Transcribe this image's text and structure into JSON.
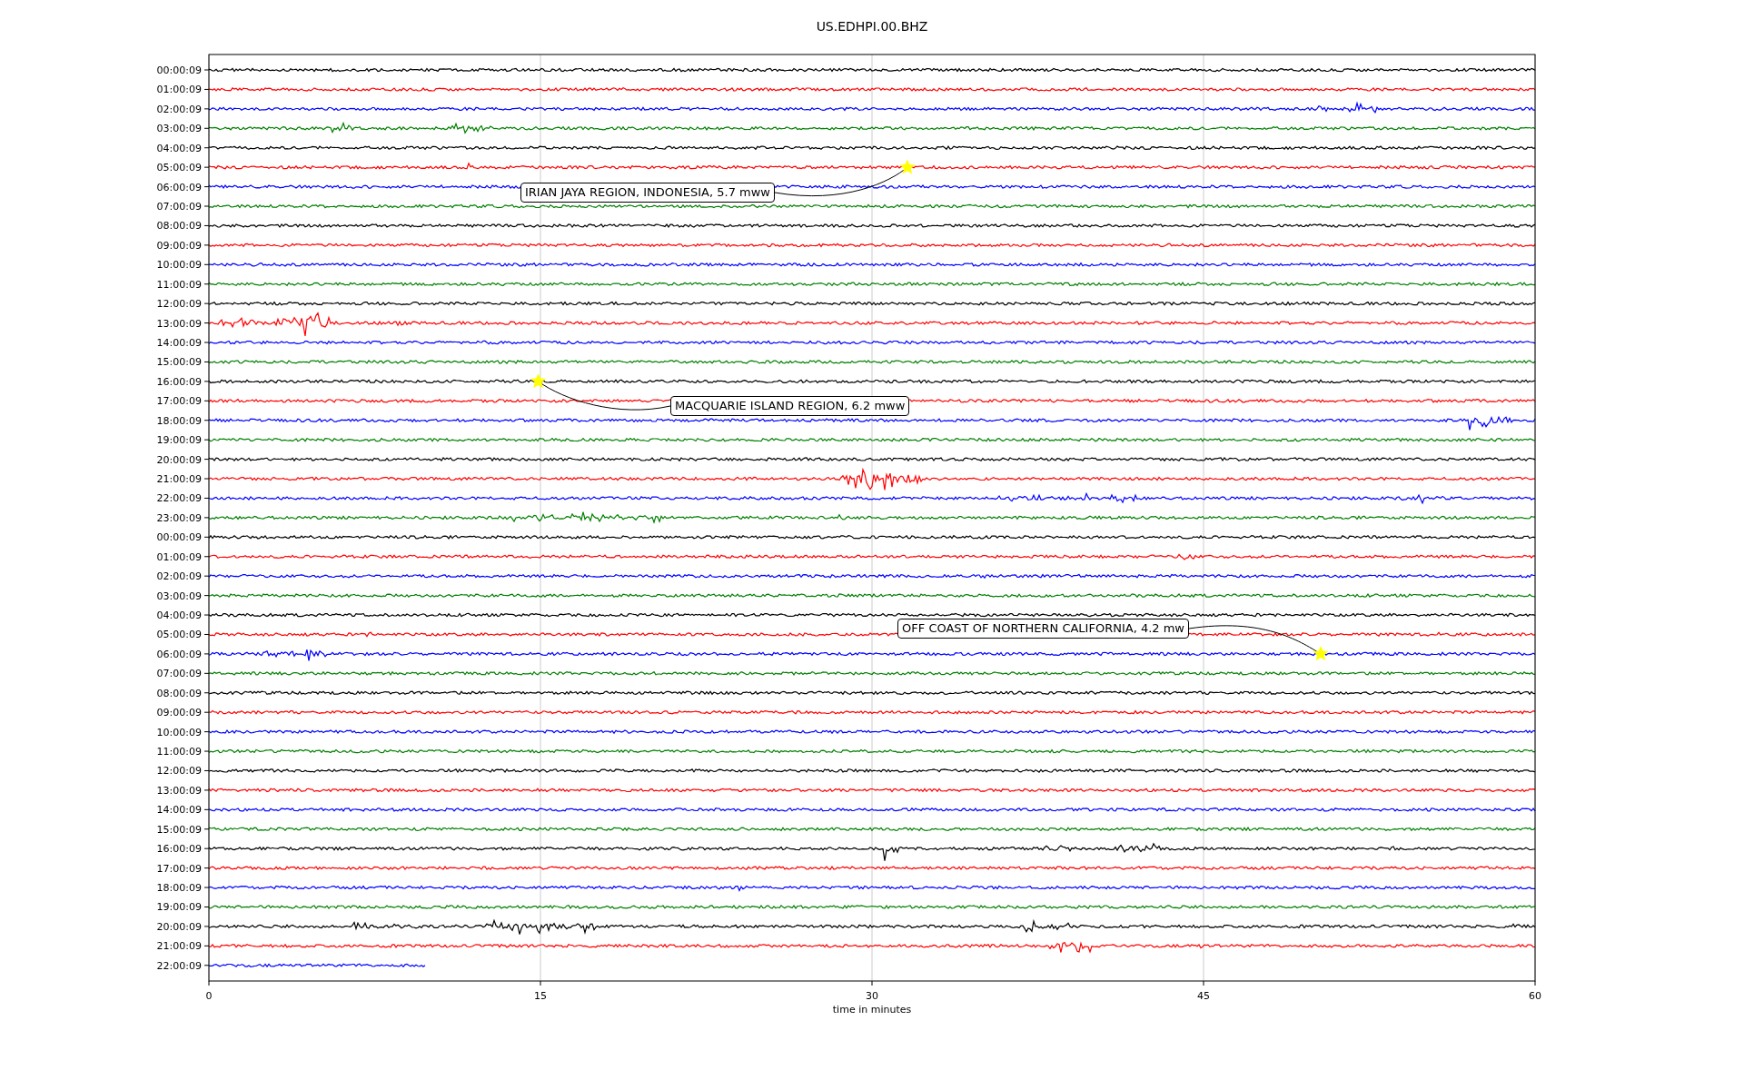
{
  "title": "US.EDHPI.00.BHZ",
  "xlabel": "time in minutes",
  "xticks": [
    "0",
    "15",
    "30",
    "45",
    "60"
  ],
  "traces": [
    {
      "label": "00:00:09",
      "color": "#000000"
    },
    {
      "label": "01:00:09",
      "color": "#ff0000"
    },
    {
      "label": "02:00:09",
      "color": "#0000ff"
    },
    {
      "label": "03:00:09",
      "color": "#008000"
    },
    {
      "label": "04:00:09",
      "color": "#000000"
    },
    {
      "label": "05:00:09",
      "color": "#ff0000"
    },
    {
      "label": "06:00:09",
      "color": "#0000ff"
    },
    {
      "label": "07:00:09",
      "color": "#008000"
    },
    {
      "label": "08:00:09",
      "color": "#000000"
    },
    {
      "label": "09:00:09",
      "color": "#ff0000"
    },
    {
      "label": "10:00:09",
      "color": "#0000ff"
    },
    {
      "label": "11:00:09",
      "color": "#008000"
    },
    {
      "label": "12:00:09",
      "color": "#000000"
    },
    {
      "label": "13:00:09",
      "color": "#ff0000"
    },
    {
      "label": "14:00:09",
      "color": "#0000ff"
    },
    {
      "label": "15:00:09",
      "color": "#008000"
    },
    {
      "label": "16:00:09",
      "color": "#000000"
    },
    {
      "label": "17:00:09",
      "color": "#ff0000"
    },
    {
      "label": "18:00:09",
      "color": "#0000ff"
    },
    {
      "label": "19:00:09",
      "color": "#008000"
    },
    {
      "label": "20:00:09",
      "color": "#000000"
    },
    {
      "label": "21:00:09",
      "color": "#ff0000"
    },
    {
      "label": "22:00:09",
      "color": "#0000ff"
    },
    {
      "label": "23:00:09",
      "color": "#008000"
    },
    {
      "label": "00:00:09",
      "color": "#000000"
    },
    {
      "label": "01:00:09",
      "color": "#ff0000"
    },
    {
      "label": "02:00:09",
      "color": "#0000ff"
    },
    {
      "label": "03:00:09",
      "color": "#008000"
    },
    {
      "label": "04:00:09",
      "color": "#000000"
    },
    {
      "label": "05:00:09",
      "color": "#ff0000"
    },
    {
      "label": "06:00:09",
      "color": "#0000ff"
    },
    {
      "label": "07:00:09",
      "color": "#008000"
    },
    {
      "label": "08:00:09",
      "color": "#000000"
    },
    {
      "label": "09:00:09",
      "color": "#ff0000"
    },
    {
      "label": "10:00:09",
      "color": "#0000ff"
    },
    {
      "label": "11:00:09",
      "color": "#008000"
    },
    {
      "label": "12:00:09",
      "color": "#000000"
    },
    {
      "label": "13:00:09",
      "color": "#ff0000"
    },
    {
      "label": "14:00:09",
      "color": "#0000ff"
    },
    {
      "label": "15:00:09",
      "color": "#008000"
    },
    {
      "label": "16:00:09",
      "color": "#000000"
    },
    {
      "label": "17:00:09",
      "color": "#ff0000"
    },
    {
      "label": "18:00:09",
      "color": "#0000ff"
    },
    {
      "label": "19:00:09",
      "color": "#008000"
    },
    {
      "label": "20:00:09",
      "color": "#000000"
    },
    {
      "label": "21:00:09",
      "color": "#ff0000"
    },
    {
      "label": "22:00:09",
      "color": "#0000ff"
    }
  ],
  "events": [
    {
      "text": "IRIAN JAYA REGION, INDONESIA, 5.7 mww"
    },
    {
      "text": "MACQUARIE ISLAND REGION, 6.2 mww"
    },
    {
      "text": "OFF COAST OF NORTHERN CALIFORNIA, 4.2 mw"
    }
  ]
}
